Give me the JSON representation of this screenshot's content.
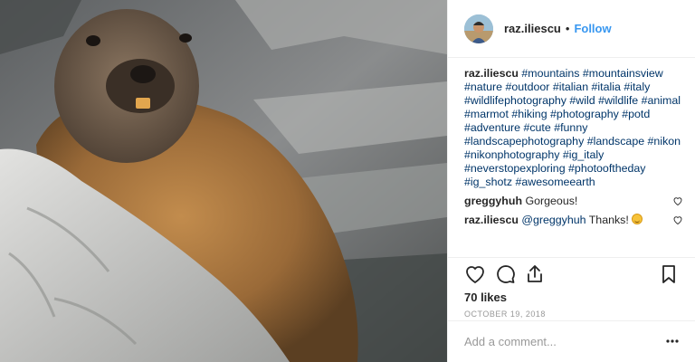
{
  "header": {
    "username": "raz.iliescu",
    "separator": "•",
    "follow_label": "Follow"
  },
  "caption": {
    "username": "raz.iliescu",
    "text": "#mountains #mountainsview #nature #outdoor #italian #italia #italy #wildlifephotography #wild #wildlife #animal #marmot #hiking #photography #potd #adventure #cute #funny #landscapephotography #landscape #nikon #nikonphotography #ig_italy #neverstopexploring #photooftheday #ig_shotz #awesomeearth"
  },
  "comments": [
    {
      "username": "greggyhuh",
      "mention": "",
      "text": "Gorgeous!"
    },
    {
      "username": "raz.iliescu",
      "mention": "@greggyhuh",
      "text": "Thanks!",
      "emoji": "grinning-face"
    }
  ],
  "likes": "70 likes",
  "date": "OCTOBER 19, 2018",
  "add_comment": {
    "placeholder": "Add a comment..."
  },
  "icons": [
    "heart-icon",
    "comment-icon",
    "share-icon",
    "bookmark-icon",
    "more-icon"
  ],
  "colors": {
    "follow": "#3897f0",
    "hashtag": "#003569",
    "meta": "#999999",
    "border": "#efefef"
  }
}
